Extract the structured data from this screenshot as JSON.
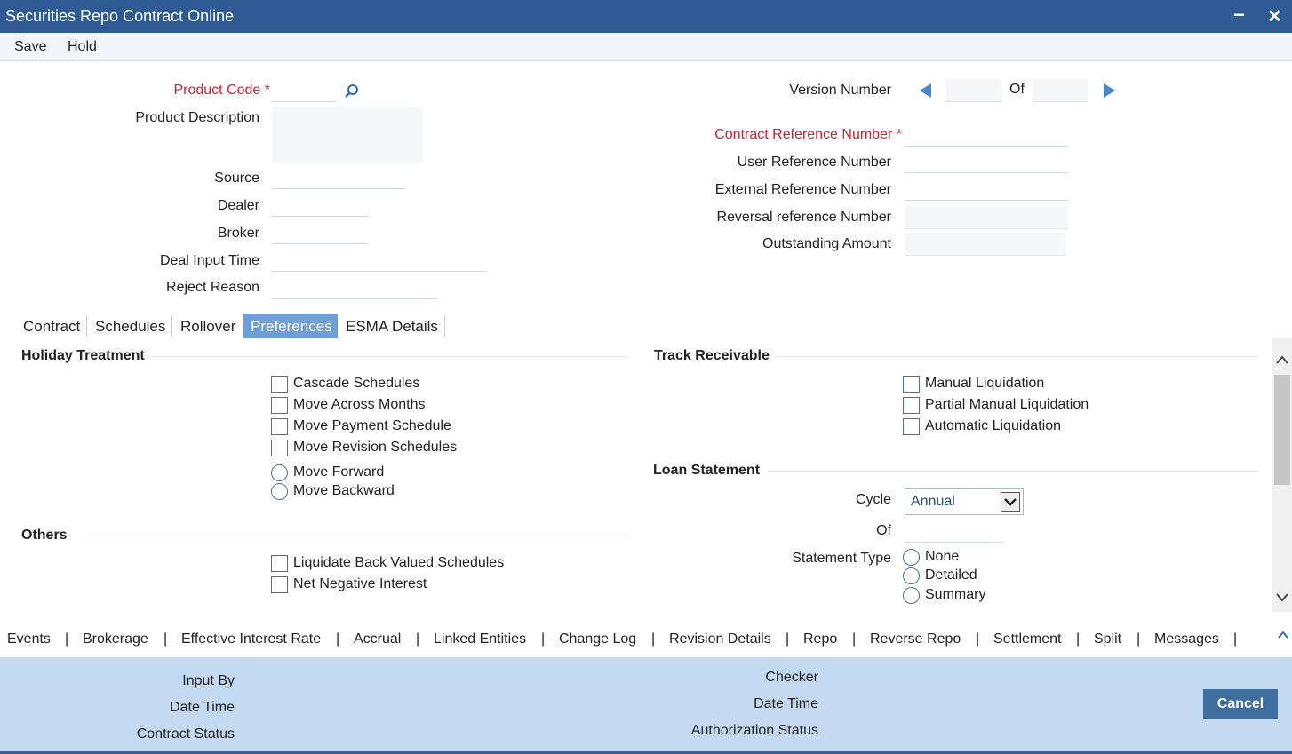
{
  "window": {
    "title": "Securities Repo Contract Online",
    "minimize": "−",
    "close": "✕"
  },
  "menu": {
    "save": "Save",
    "hold": "Hold"
  },
  "header": {
    "product_code": "Product Code",
    "required_marker": "*",
    "product_description": "Product Description",
    "source": "Source",
    "dealer": "Dealer",
    "broker": "Broker",
    "deal_input_time": "Deal Input Time",
    "reject_reason": "Reject Reason",
    "version_number": "Version Number",
    "version_of": "Of",
    "contract_reference_number": "Contract Reference Number",
    "user_reference_number": "User Reference Number",
    "external_reference_number": "External Reference Number",
    "reversal_reference_number": "Reversal reference Number",
    "outstanding_amount": "Outstanding Amount"
  },
  "tabs": [
    "Contract",
    "Schedules",
    "Rollover",
    "Preferences",
    "ESMA Details"
  ],
  "active_tab": "Preferences",
  "holiday": {
    "title": "Holiday Treatment",
    "checkboxes": [
      "Cascade Schedules",
      "Move Across Months",
      "Move Payment Schedule",
      "Move Revision Schedules"
    ],
    "radios": [
      "Move Forward",
      "Move Backward"
    ]
  },
  "others": {
    "title": "Others",
    "checkboxes": [
      "Liquidate Back Valued Schedules",
      "Net Negative Interest"
    ]
  },
  "track": {
    "title": "Track Receivable",
    "checkboxes": [
      "Manual Liquidation",
      "Partial Manual Liquidation",
      "Automatic Liquidation"
    ]
  },
  "loan": {
    "title": "Loan Statement",
    "cycle_label": "Cycle",
    "cycle_value": "Annual",
    "of_label": "Of",
    "statement_type_label": "Statement Type",
    "statement_types": [
      "None",
      "Detailed",
      "Summary"
    ]
  },
  "bottom_links": [
    "Events",
    "Brokerage",
    "Effective Interest Rate",
    "Accrual",
    "Linked Entities",
    "Change Log",
    "Revision Details",
    "Repo",
    "Reverse Repo",
    "Settlement",
    "Split",
    "Messages"
  ],
  "link_separator": "|",
  "footer": {
    "input_by": "Input By",
    "date_time": "Date Time",
    "contract_status": "Contract Status",
    "checker": "Checker",
    "date_time_2": "Date Time",
    "authorization_status": "Authorization Status",
    "cancel": "Cancel"
  },
  "colors": {
    "titlebar": "#2f5b95",
    "accent": "#6e9fd8",
    "required": "#d2202f",
    "footer": "#c3daf0"
  }
}
